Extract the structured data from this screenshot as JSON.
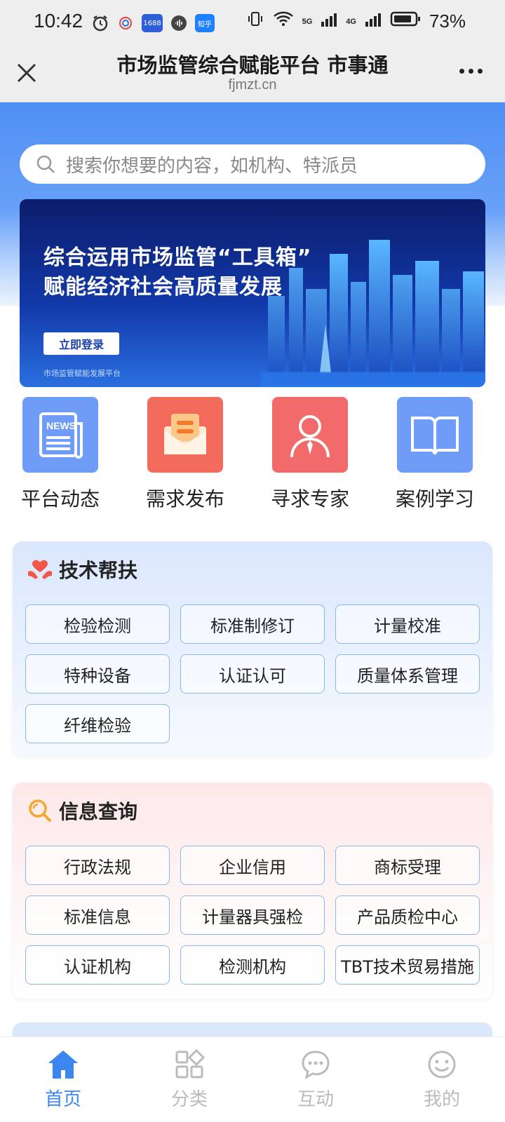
{
  "status_bar": {
    "time": "10:42",
    "battery": "73%",
    "app_icons": [
      "1688",
      "知乎"
    ],
    "network": [
      "5G",
      "4G"
    ]
  },
  "browser": {
    "title": "市场监管综合赋能平台 市事通",
    "domain": "fjmzt.cn"
  },
  "search": {
    "placeholder": "搜索你想要的内容，如机构、特派员"
  },
  "banner": {
    "line1": "综合运用市场监管“工具箱”",
    "line2": "赋能经济社会高质量发展",
    "button": "立即登录",
    "footer": "市场监管赋能发展平台"
  },
  "quick_menu": [
    {
      "label": "平台动态",
      "icon": "news-icon",
      "color": "#6e9cf7"
    },
    {
      "label": "需求发布",
      "icon": "envelope-icon",
      "color": "#f26a5c"
    },
    {
      "label": "寻求专家",
      "icon": "expert-icon",
      "color": "#f26a6a"
    },
    {
      "label": "案例学习",
      "icon": "book-icon",
      "color": "#6e9cf7"
    }
  ],
  "tech_support": {
    "title": "技术帮扶",
    "items": [
      "检验检测",
      "标准制修订",
      "计量校准",
      "特种设备",
      "认证认可",
      "质量体系管理",
      "纤维检验"
    ]
  },
  "info_query": {
    "title": "信息查询",
    "items": [
      "行政法规",
      "企业信用",
      "商标受理",
      "标准信息",
      "计量器具强检",
      "产品质检中心",
      "认证机构",
      "检测机构",
      "TBT技术贸易措施"
    ]
  },
  "tabbar": [
    {
      "label": "首页",
      "icon": "home-icon",
      "active": true
    },
    {
      "label": "分类",
      "icon": "category-icon",
      "active": false
    },
    {
      "label": "互动",
      "icon": "chat-icon",
      "active": false
    },
    {
      "label": "我的",
      "icon": "smile-icon",
      "active": false
    }
  ],
  "colors": {
    "primary": "#3c86f0",
    "hero": "#4f8ff4",
    "tag_border": "#8bb8e8"
  }
}
